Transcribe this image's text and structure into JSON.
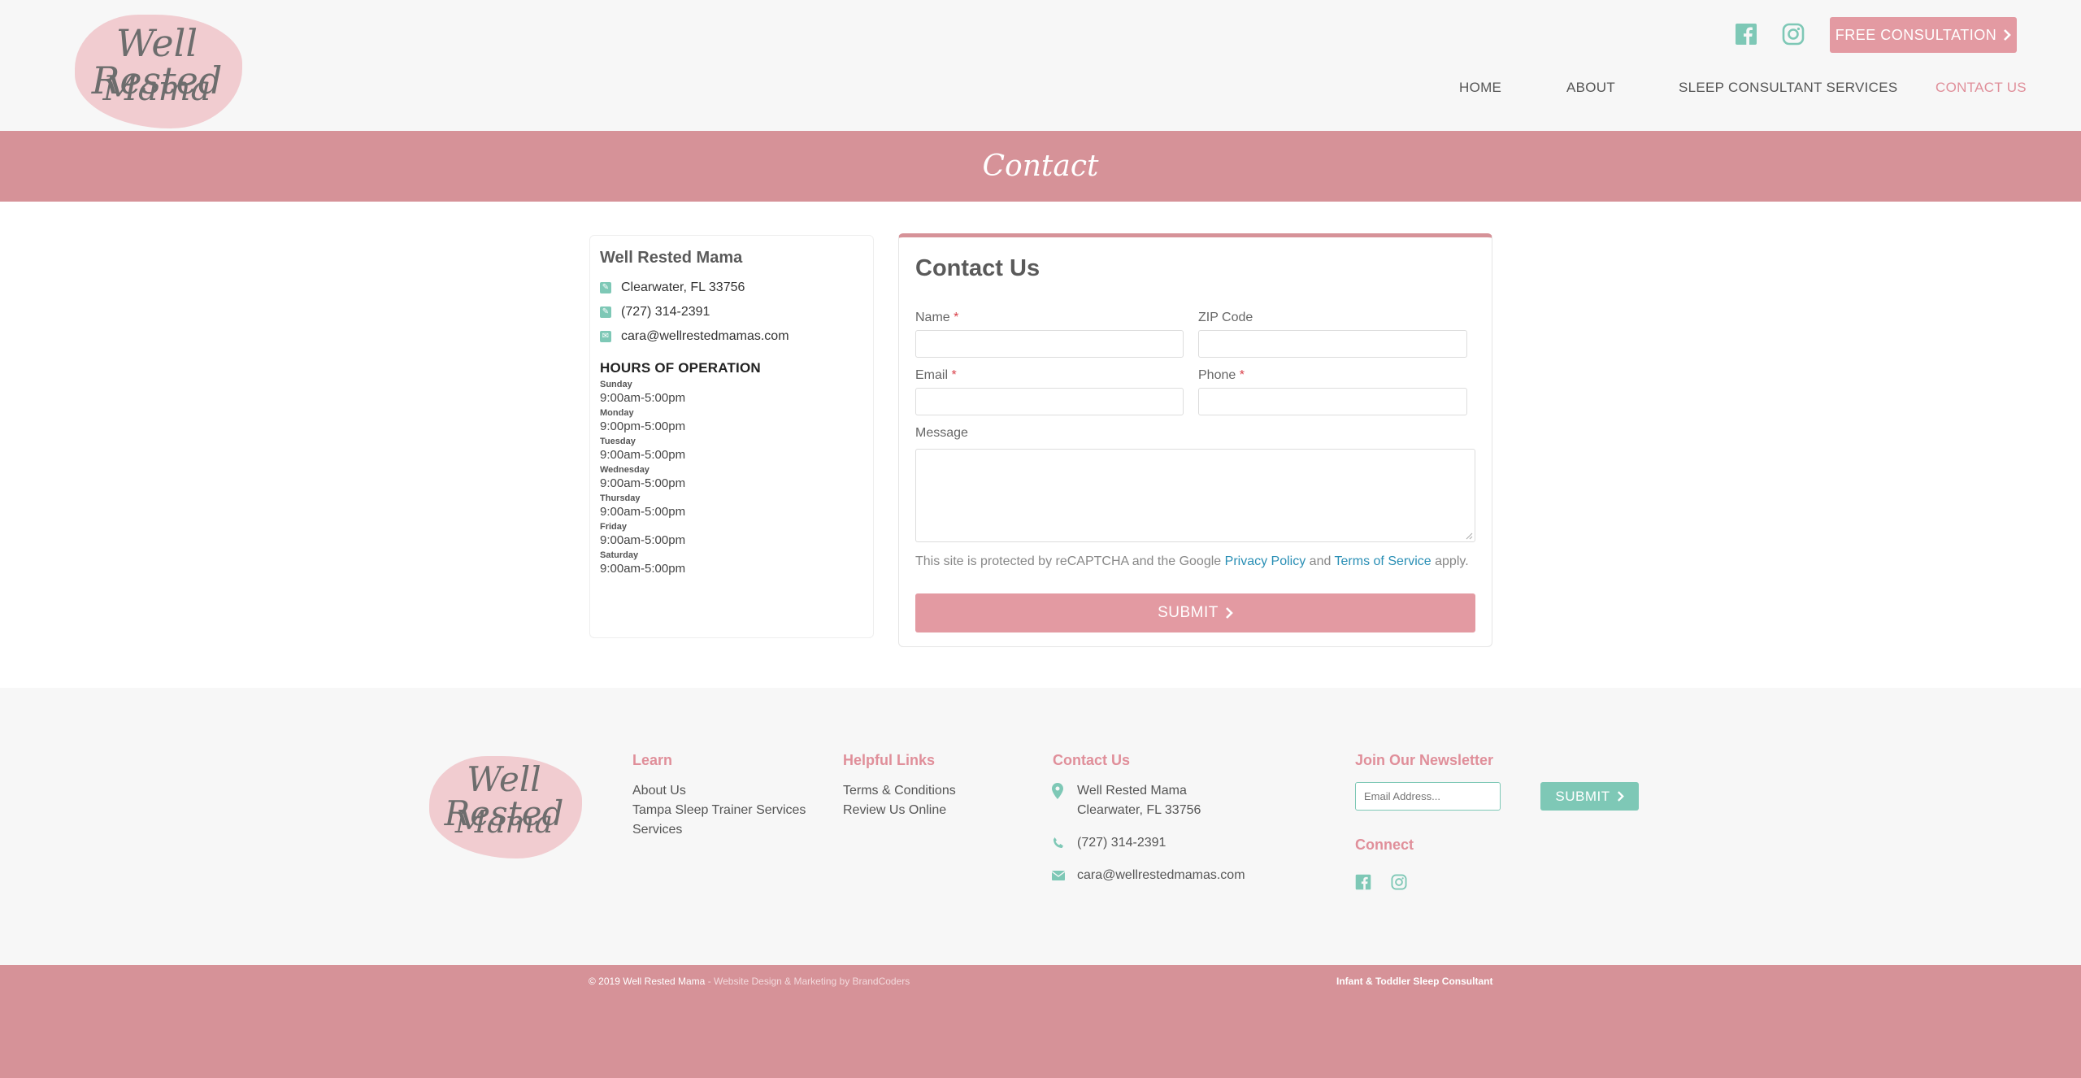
{
  "header": {
    "logo_line1": "Well Rested",
    "logo_line2": "Mama",
    "social": {
      "facebook_icon": "facebook-icon",
      "instagram_icon": "instagram-icon"
    },
    "cta_label": "FREE CONSULTATION",
    "nav": [
      {
        "label": "HOME"
      },
      {
        "label": "ABOUT"
      },
      {
        "label": "SLEEP CONSULTANT SERVICES"
      },
      {
        "label": "CONTACT US",
        "active": true
      }
    ]
  },
  "banner": {
    "title": "Contact"
  },
  "info_card": {
    "name": "Well Rested Mama",
    "address": "Clearwater, FL 33756",
    "phone": "(727) 314-2391",
    "email": "cara@wellrestedmamas.com",
    "hours_title": "HOURS OF OPERATION",
    "hours": [
      {
        "day": "Sunday",
        "time": "9:00am-5:00pm"
      },
      {
        "day": "Monday",
        "time": "9:00pm-5:00pm"
      },
      {
        "day": "Tuesday",
        "time": "9:00am-5:00pm"
      },
      {
        "day": "Wednesday",
        "time": "9:00am-5:00pm"
      },
      {
        "day": "Thursday",
        "time": "9:00am-5:00pm"
      },
      {
        "day": "Friday",
        "time": "9:00am-5:00pm"
      },
      {
        "day": "Saturday",
        "time": "9:00am-5:00pm"
      }
    ]
  },
  "form": {
    "title": "Contact Us",
    "name_label": "Name",
    "zip_label": "ZIP Code",
    "email_label": "Email",
    "phone_label": "Phone",
    "message_label": "Message",
    "required_mark": "*",
    "recaptcha_prefix": "This site is protected by reCAPTCHA and the Google",
    "privacy_link": "Privacy Policy",
    "recaptcha_and": "and",
    "terms_link": "Terms of Service",
    "recaptcha_suffix": "apply.",
    "submit_label": "SUBMIT"
  },
  "footer": {
    "logo_line1": "Well Rested",
    "logo_line2": "Mama",
    "learn": {
      "heading": "Learn",
      "links": [
        "About Us",
        "Tampa Sleep Trainer Services",
        "Services"
      ]
    },
    "helpful": {
      "heading": "Helpful Links",
      "links": [
        "Terms & Conditions",
        "Review Us Online"
      ]
    },
    "contact": {
      "heading": "Contact Us",
      "name": "Well Rested Mama",
      "address": "Clearwater, FL 33756",
      "phone": "(727) 314-2391",
      "email": "cara@wellrestedmamas.com"
    },
    "newsletter": {
      "heading": "Join Our Newsletter",
      "placeholder": "Email Address...",
      "submit_label": "SUBMIT"
    },
    "connect": {
      "heading": "Connect"
    }
  },
  "bottom_bar": {
    "copyright": "© 2019 Well Rested Mama",
    "credit": " - Website Design & Marketing by BrandCoders",
    "tagline": "Infant & Toddler Sleep Consultant"
  },
  "colors": {
    "brand_pink": "#d69298",
    "button_pink": "#e39aa2",
    "accent_teal": "#7ec8b6",
    "link_blue": "#2a8fb5"
  }
}
